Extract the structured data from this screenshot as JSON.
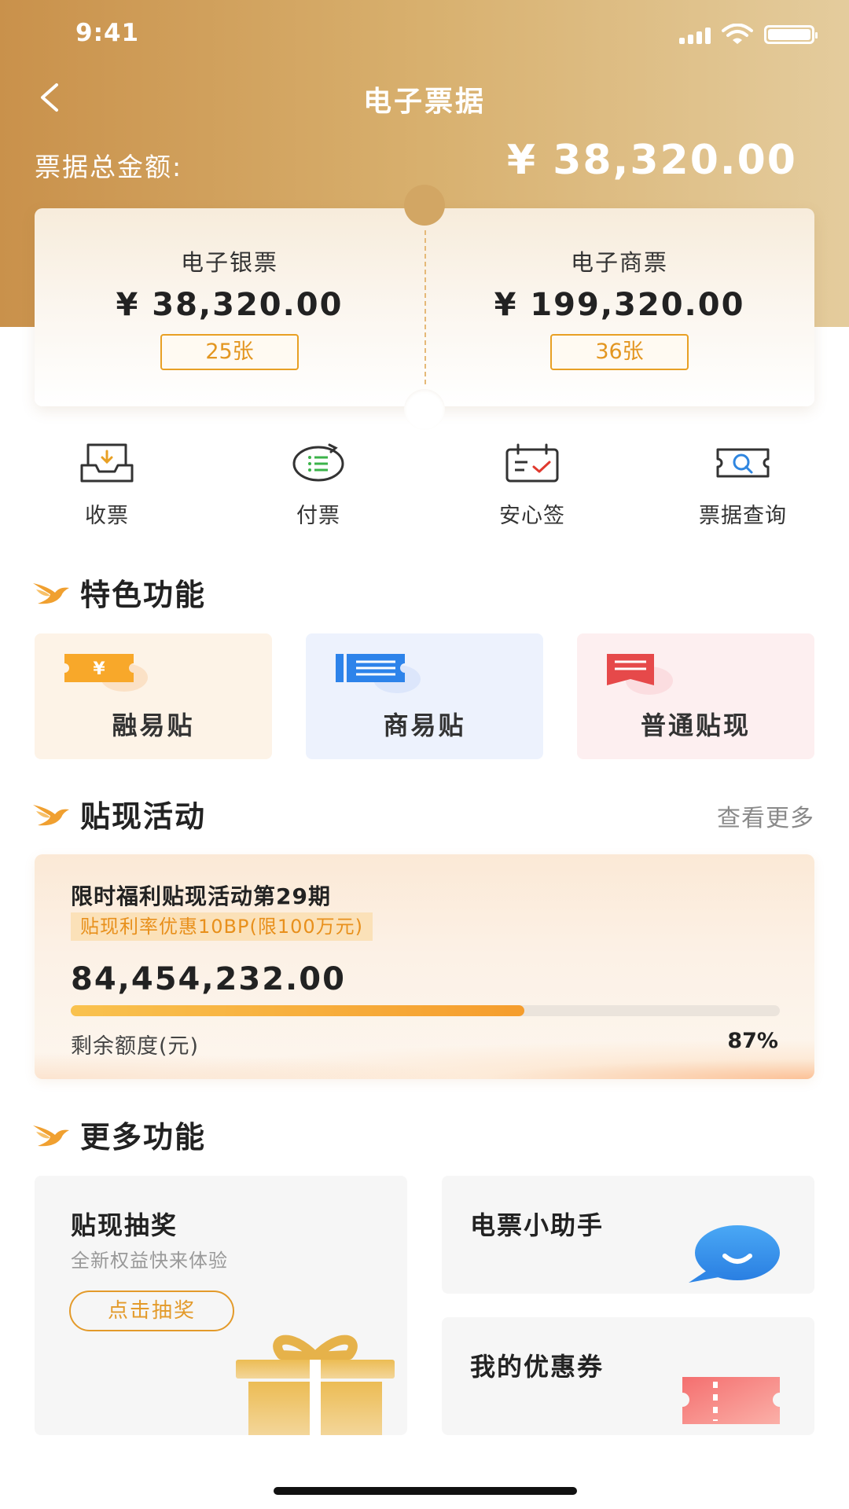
{
  "status_bar": {
    "time": "9:41"
  },
  "header": {
    "title": "电子票据",
    "total_label": "票据总金额:",
    "total_amount": "¥ 38,320.00"
  },
  "ticket_summary": [
    {
      "name": "电子银票",
      "amount": "¥ 38,320.00",
      "count": "25张"
    },
    {
      "name": "电子商票",
      "amount": "¥ 199,320.00",
      "count": "36张"
    }
  ],
  "quick_actions": [
    {
      "label": "收票",
      "icon": "receive-ticket-icon"
    },
    {
      "label": "付票",
      "icon": "pay-ticket-icon"
    },
    {
      "label": "安心签",
      "icon": "calendar-check-icon"
    },
    {
      "label": "票据查询",
      "icon": "ticket-search-icon"
    }
  ],
  "features": {
    "title": "特色功能",
    "items": [
      {
        "label": "融易贴",
        "icon": "yuan-ticket-icon",
        "bg": "#fdf3e7"
      },
      {
        "label": "商易贴",
        "icon": "list-ticket-icon",
        "bg": "#edf2fd"
      },
      {
        "label": "普通贴现",
        "icon": "bookmark-icon",
        "bg": "#fdeff0"
      }
    ]
  },
  "activities": {
    "title": "贴现活动",
    "more": "查看更多",
    "promo": {
      "title": "限时福利贴现活动第29期",
      "tag": "贴现利率优惠10BP(限100万元)",
      "amount": "84,454,232.00",
      "progress": 0.64,
      "remain_label": "剩余额度(元)",
      "percent": "87%"
    }
  },
  "more_features": {
    "title": "更多功能",
    "lottery": {
      "title": "贴现抽奖",
      "subtitle": "全新权益快来体验",
      "button": "点击抽奖"
    },
    "assistant": {
      "title": "电票小助手"
    },
    "coupons": {
      "title": "我的优惠券"
    }
  },
  "colors": {
    "accent": "#e39a2a",
    "header_start": "#c9914b",
    "header_end": "#e4cc9d"
  }
}
